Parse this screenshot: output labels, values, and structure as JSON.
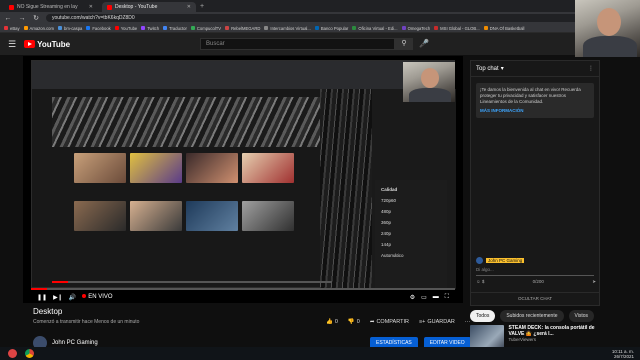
{
  "browser": {
    "tabs": [
      {
        "label": "NO Sigue Streaming en lay",
        "active": false
      },
      {
        "label": "Desktop - YouTube",
        "active": true
      }
    ],
    "new_tab": "+",
    "url": "youtube.com/watch?v=tbK6kqDZ8D0",
    "bookmarks": [
      {
        "label": "eBay",
        "color": "#e53238"
      },
      {
        "label": "Amazon.com",
        "color": "#ff9900"
      },
      {
        "label": "bm-caspa",
        "color": "#4a90d9"
      },
      {
        "label": "Facebook",
        "color": "#1877f2"
      },
      {
        "label": "YouTube",
        "color": "#ff0000"
      },
      {
        "label": "Twitch",
        "color": "#9146ff"
      },
      {
        "label": "Traductor",
        "color": "#4285f4"
      },
      {
        "label": "CompucolTV",
        "color": "#33aa55"
      },
      {
        "label": "RebelMEGARD",
        "color": "#cc4444"
      },
      {
        "label": "Intercambios Virtual...",
        "color": "#888888"
      },
      {
        "label": "Banco Popular",
        "color": "#0066b3"
      },
      {
        "label": "Oficina Virtual - Edi...",
        "color": "#2b8a3e"
      },
      {
        "label": "OmegaTech",
        "color": "#6f42c1"
      },
      {
        "label": "MSI Global - GLOB...",
        "color": "#c92a2a"
      },
      {
        "label": "DNA Of Basketball",
        "color": "#f08c00"
      }
    ]
  },
  "youtube": {
    "logo_text": "YouTube",
    "search_placeholder": "Buscar"
  },
  "player": {
    "live_label": "EN VIVO",
    "quality_menu": {
      "title": "Calidad",
      "options": [
        "720p60",
        "480p",
        "360p",
        "240p",
        "144p",
        "Automático"
      ]
    },
    "inner_time": "0:00"
  },
  "video": {
    "title": "Desktop",
    "description": "Comenzó a transmitir hace Menos de un minuto",
    "likes": "0",
    "dislikes": "0",
    "share_label": "COMPARTIR",
    "save_label": "GUARDAR",
    "channel_name": "John PC Gaming",
    "stats_button": "ESTADÍSTICAS",
    "edit_button": "EDITAR VIDEO"
  },
  "chat": {
    "header": "Top chat",
    "welcome_text": "¡Te damos la bienvenida al chat en vivo! Recuerda proteger tu privacidad y satisfacer nuestros Lineamientos de la Comunidad.",
    "more_info": "MÁS INFORMACIÓN",
    "user_badge": "John PC Gaming",
    "input_placeholder": "Di algo...",
    "char_count": "0/200",
    "hide_chat": "OCULTAR CHAT"
  },
  "related": {
    "chips": [
      {
        "label": "Todos",
        "active": true
      },
      {
        "label": "Subidos recientemente",
        "active": false
      },
      {
        "label": "Vistos",
        "active": false
      }
    ],
    "first": {
      "title": "STEAM DECK: la consola portátil de VALVE 🤷 ¿será l...",
      "channel": "TuberViewers"
    }
  },
  "taskbar": {
    "time": "10:11 a. m.",
    "date": "26/7/2021"
  }
}
